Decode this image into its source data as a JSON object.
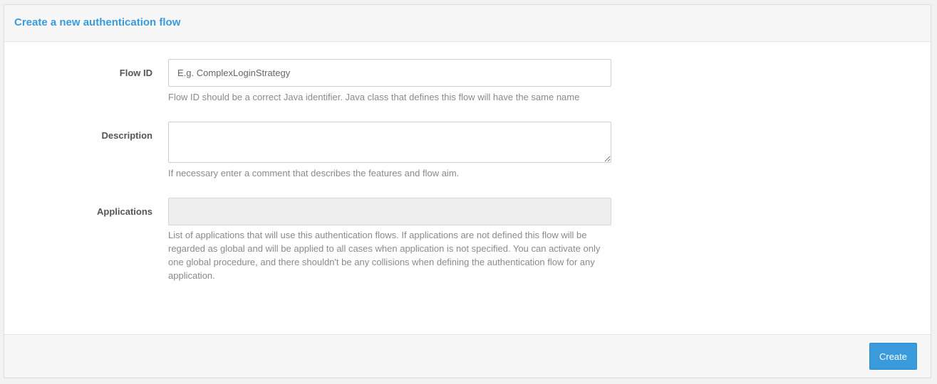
{
  "panel": {
    "title": "Create a new authentication flow"
  },
  "form": {
    "flow_id": {
      "label": "Flow ID",
      "value": "",
      "placeholder": "E.g. ComplexLoginStrategy",
      "help": "Flow ID should be a correct Java identifier. Java class that defines this flow will have the same name"
    },
    "description": {
      "label": "Description",
      "value": "",
      "placeholder": "",
      "help": "If necessary enter a comment that describes the features and flow aim."
    },
    "applications": {
      "label": "Applications",
      "value": "",
      "help": "List of applications that will use this authentication flows. If applications are not defined this flow will be regarded as global and will be applied to all cases when application is not specified. You can activate only one global procedure, and there shouldn't be any collisions when defining the authentication flow for any application."
    }
  },
  "footer": {
    "create_label": "Create"
  },
  "colors": {
    "accent": "#3a9bdc",
    "help_text": "#8a8a8a",
    "label_text": "#555555"
  }
}
